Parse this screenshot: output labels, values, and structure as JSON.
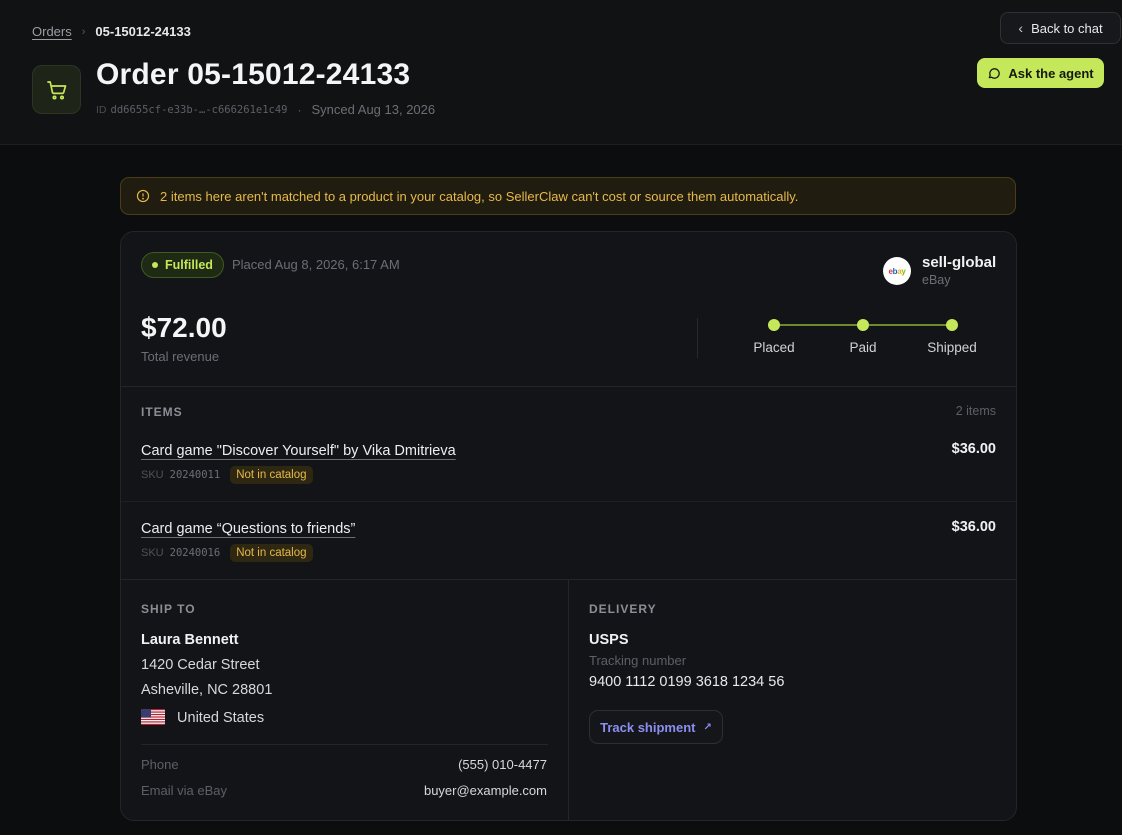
{
  "breadcrumb": {
    "parent": "Orders",
    "separator": "›",
    "current": "05-15012-24133"
  },
  "header": {
    "title": "Order 05-15012-24133",
    "id_label": "ID",
    "id_value": "dd6655cf-e33b-…-c666261e1c49",
    "meta_separator": "·",
    "synced": "Synced Aug 13, 2026",
    "back_label": "Back to chat",
    "agent_label": "Ask the agent",
    "icons": [
      "cart-icon",
      "chevron-left-icon",
      "chat-bubble-icon"
    ]
  },
  "warning": {
    "icon": "info-circle-icon",
    "text": "2 items here aren't matched to a product in your catalog, so SellerClaw can't cost or source them automatically."
  },
  "order": {
    "status": "Fulfilled",
    "placed_at": "Placed Aug 8, 2026, 6:17 AM",
    "store_name": "sell-global",
    "store_channel": "eBay",
    "store_logo_text": "ebay",
    "revenue": "$72.00",
    "revenue_label": "Total revenue",
    "timeline": [
      "Placed",
      "Paid",
      "Shipped"
    ]
  },
  "items_section": {
    "heading": "ITEMS",
    "count": "2 items",
    "sku_label": "SKU",
    "items": [
      {
        "name": "Card game \"Discover Yourself\" by Vika Dmitrieva",
        "price": "$36.00",
        "sku": "20240011",
        "badge": "Not in catalog"
      },
      {
        "name": "Card game “Questions to friends”",
        "price": "$36.00",
        "sku": "20240016",
        "badge": "Not in catalog"
      }
    ]
  },
  "ship_to": {
    "heading": "SHIP TO",
    "name": "Laura Bennett",
    "street": "1420 Cedar Street",
    "city": "Asheville, NC 28801",
    "country": "United States",
    "phone_label": "Phone",
    "phone": "(555) 010-4477",
    "email_label": "Email via eBay",
    "email": "buyer@example.com"
  },
  "delivery": {
    "heading": "DELIVERY",
    "carrier": "USPS",
    "tracking_label": "Tracking number",
    "tracking_number": "9400 1112 0199 3618 1234 56",
    "track_label": "Track shipment",
    "track_icon": "external-arrow-icon"
  },
  "colors": {
    "accent": "#c5e85a",
    "warning": "#e6b94a",
    "link": "#8b8ff0",
    "background": "#0c0d0f"
  }
}
